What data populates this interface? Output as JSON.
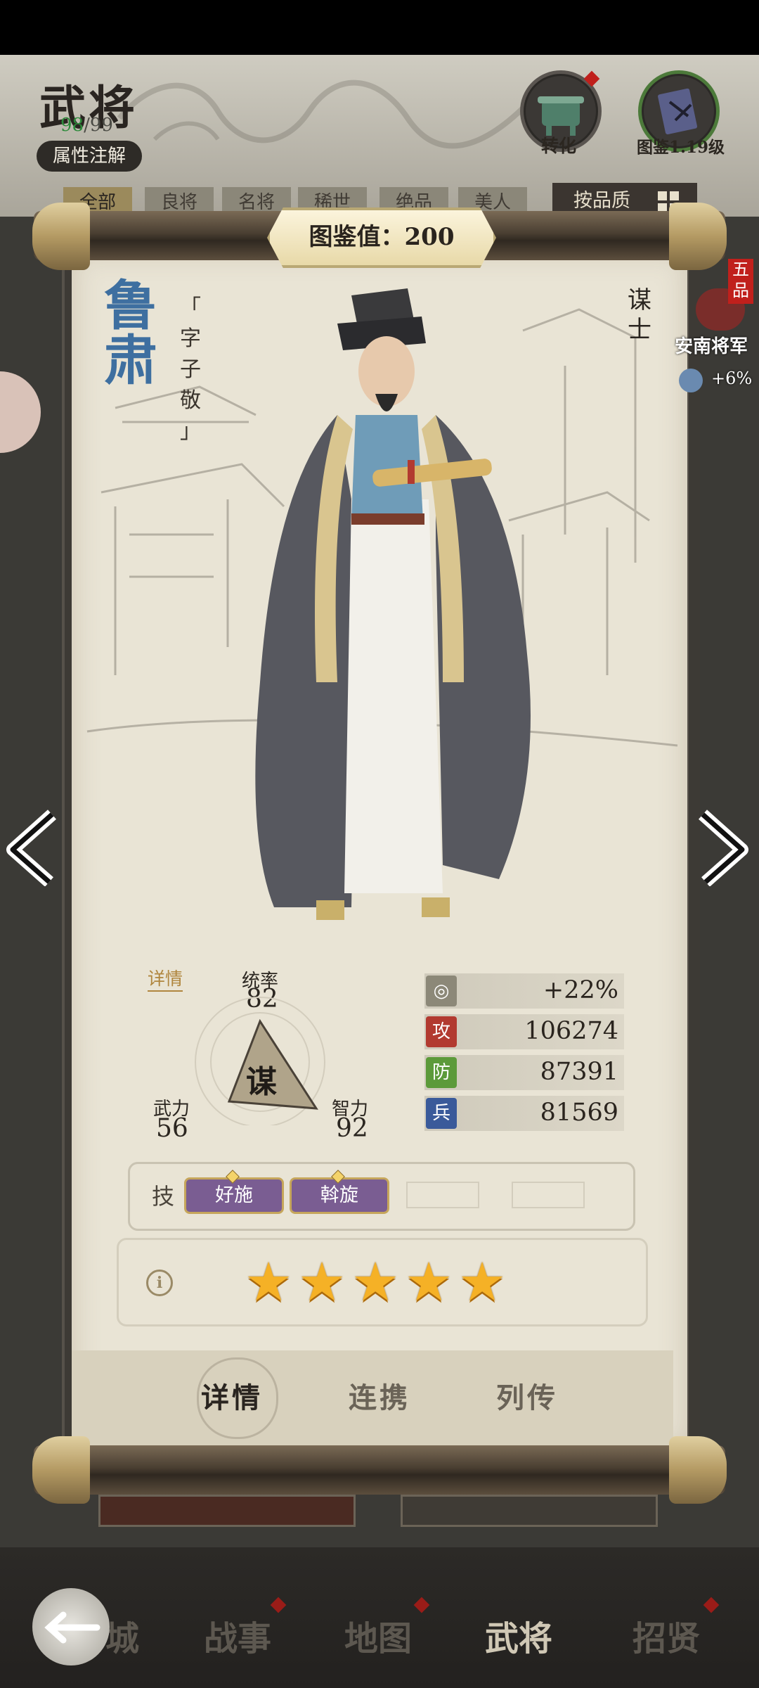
{
  "header": {
    "title": "武将",
    "count_current": "98",
    "count_total": "/99",
    "attr_button": "属性注解",
    "convert_label": "转化",
    "atlas_label": "图鉴1.19级"
  },
  "filters": {
    "tabs": [
      "全部",
      "良将",
      "名将",
      "稀世",
      "绝品",
      "美人"
    ],
    "sort_label": "按品质"
  },
  "general": {
    "atlas_value": "图鉴值：200",
    "name": "鲁肃",
    "courtesy_open": "「",
    "courtesy_label": "字",
    "courtesy_name": "子敬",
    "courtesy_close": "」",
    "role": "谋士",
    "rank_badge": "五品",
    "rank_title": "安南将军",
    "rank_buff": "+6%",
    "detail_link": "详情",
    "type_char": "谋",
    "stats": {
      "command_label": "统率",
      "command": "82",
      "force_label": "武力",
      "force": "56",
      "intel_label": "智力",
      "intel": "92"
    },
    "bars": [
      {
        "icon": "bonus-icon",
        "label": "",
        "value": "+22%"
      },
      {
        "icon_text": "攻",
        "value": "106274",
        "color": "#b23a30"
      },
      {
        "icon_text": "防",
        "value": "87391",
        "color": "#5c9a3a"
      },
      {
        "icon_text": "兵",
        "value": "81569",
        "color": "#3a5a9a"
      }
    ],
    "skills_label": "技",
    "skills": [
      "好施",
      "斡旋"
    ],
    "stars": 5,
    "star_char": "★",
    "info_char": "i"
  },
  "detail_tabs": [
    "详情",
    "连携",
    "列传"
  ],
  "bottom_nav": [
    "城",
    "战事",
    "地图",
    "武将",
    "招贤"
  ],
  "colors": {
    "accent_gold": "#f5b126",
    "name_blue": "#3e6fa0",
    "skill_purple": "#7a5d92",
    "badge_red": "#c0201c"
  }
}
